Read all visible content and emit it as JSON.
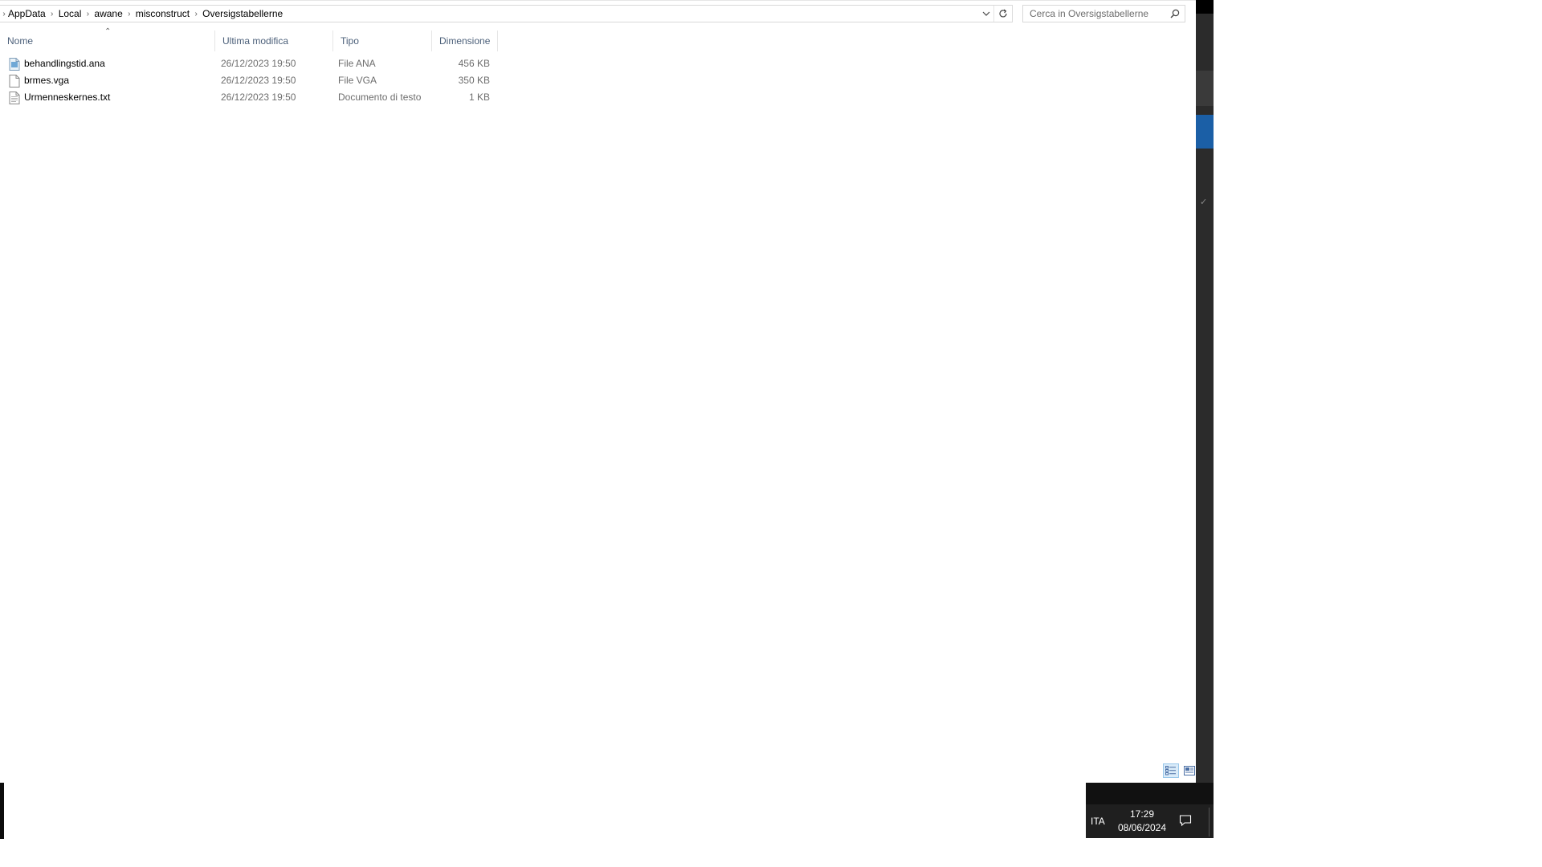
{
  "breadcrumb": [
    "AppData",
    "Local",
    "awane",
    "misconstruct",
    "Oversigstabellerne"
  ],
  "search": {
    "placeholder": "Cerca in Oversigstabellerne"
  },
  "columns": {
    "name": "Nome",
    "modified": "Ultima modifica",
    "type": "Tipo",
    "size": "Dimensione"
  },
  "files": [
    {
      "name": "behandlingstid.ana",
      "modified": "26/12/2023 19:50",
      "type": "File ANA",
      "size": "456 KB",
      "icon": "ana-file-icon"
    },
    {
      "name": "brmes.vga",
      "modified": "26/12/2023 19:50",
      "type": "File VGA",
      "size": "350 KB",
      "icon": "generic-file-icon"
    },
    {
      "name": "Urmenneskernes.txt",
      "modified": "26/12/2023 19:50",
      "type": "Documento di testo",
      "size": "1 KB",
      "icon": "text-file-icon"
    }
  ],
  "taskbar": {
    "language": "ITA",
    "time": "17:29",
    "date": "08/06/2024"
  },
  "colors": {
    "header_text": "#4c607a",
    "accent": "#1b5fa6",
    "taskbar": "#1f1f1f"
  }
}
